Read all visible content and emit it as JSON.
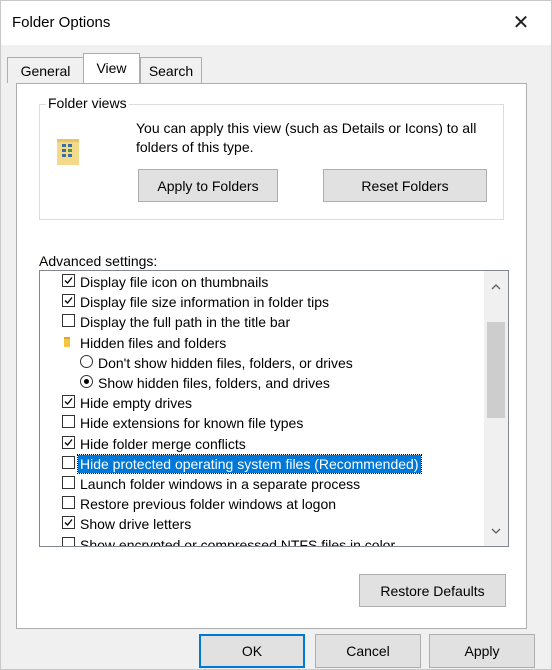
{
  "window": {
    "title": "Folder Options",
    "close_glyph": "✕"
  },
  "tabs": [
    {
      "label": "General",
      "active": false
    },
    {
      "label": "View",
      "active": true
    },
    {
      "label": "Search",
      "active": false
    }
  ],
  "folder_views": {
    "legend": "Folder views",
    "description": "You can apply this view (such as Details or Icons) to all folders of this type.",
    "apply_label": "Apply to Folders",
    "reset_label": "Reset Folders"
  },
  "advanced": {
    "label": "Advanced settings:",
    "items": [
      {
        "kind": "checkbox",
        "label": "Display file icon on thumbnails",
        "checked": true
      },
      {
        "kind": "checkbox",
        "label": "Display file size information in folder tips",
        "checked": true
      },
      {
        "kind": "checkbox",
        "label": "Display the full path in the title bar",
        "checked": false
      },
      {
        "kind": "folder",
        "label": "Hidden files and folders"
      },
      {
        "kind": "radio",
        "label": "Don't show hidden files, folders, or drives",
        "checked": false
      },
      {
        "kind": "radio",
        "label": "Show hidden files, folders, and drives",
        "checked": true
      },
      {
        "kind": "checkbox",
        "label": "Hide empty drives",
        "checked": true
      },
      {
        "kind": "checkbox",
        "label": "Hide extensions for known file types",
        "checked": false
      },
      {
        "kind": "checkbox",
        "label": "Hide folder merge conflicts",
        "checked": true
      },
      {
        "kind": "checkbox",
        "label": "Hide protected operating system files (Recommended)",
        "checked": false,
        "selected": true
      },
      {
        "kind": "checkbox",
        "label": "Launch folder windows in a separate process",
        "checked": false
      },
      {
        "kind": "checkbox",
        "label": "Restore previous folder windows at logon",
        "checked": false
      },
      {
        "kind": "checkbox",
        "label": "Show drive letters",
        "checked": true
      },
      {
        "kind": "checkbox",
        "label": "Show encrypted or compressed NTFS files in color",
        "checked": false
      }
    ],
    "restore_defaults_label": "Restore Defaults"
  },
  "footer": {
    "ok_label": "OK",
    "cancel_label": "Cancel",
    "apply_label": "Apply"
  },
  "colors": {
    "selection": "#0078d7",
    "accent": "#0078d7"
  },
  "icons": {
    "close": "close-icon",
    "folder_view": "folder-view-icon",
    "folder": "folder-icon",
    "scroll_up": "chevron-up-icon",
    "scroll_down": "chevron-down-icon"
  }
}
